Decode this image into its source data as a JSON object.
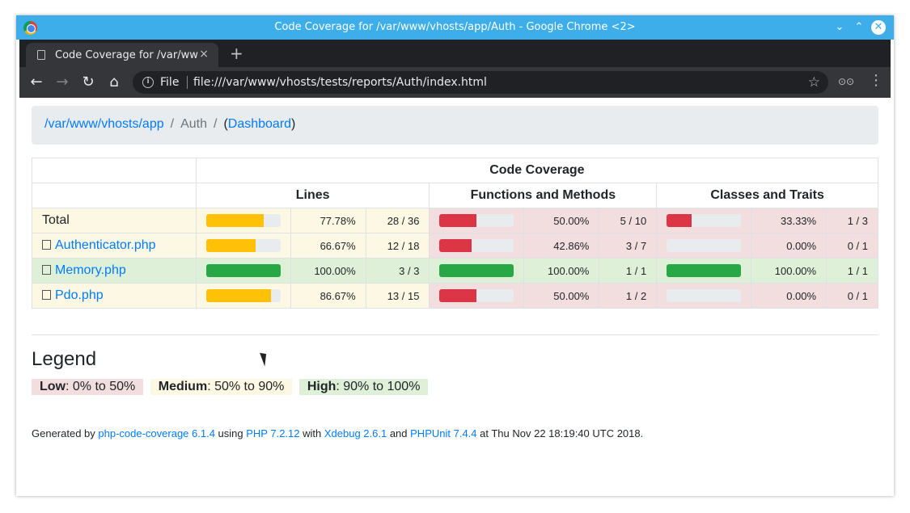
{
  "window": {
    "title": "Code Coverage for /var/www/vhosts/app/Auth - Google Chrome <2>"
  },
  "tab": {
    "title": "Code Coverage for /var/ww",
    "close": "×",
    "new_tab": "+"
  },
  "toolbar": {
    "back": "←",
    "forward": "→",
    "reload": "↻",
    "home": "⌂",
    "file_label": "File",
    "url": "file:///var/www/vhosts/tests/reports/Auth/index.html",
    "star": "☆",
    "ext": "⊙⊙",
    "menu": "⋮"
  },
  "breadcrumb": {
    "root": "/var/www/vhosts/app",
    "sep1": "/",
    "current": "Auth",
    "sep2": "/",
    "open_paren": "(",
    "dashboard": "Dashboard",
    "close_paren": ")"
  },
  "table": {
    "header_main": "Code Coverage",
    "col_lines": "Lines",
    "col_functions": "Functions and Methods",
    "col_classes": "Classes and Traits",
    "rows": [
      {
        "name": "Total",
        "is_file": false,
        "lines_fill": 0.7778,
        "lines_color": "#ffc107",
        "lines_pct": "77.78%",
        "lines_num": "28 / 36",
        "lines_bg": "bg-warning",
        "func_fill": 0.5,
        "func_color": "#dc3545",
        "func_pct": "50.00%",
        "func_num": "5 / 10",
        "func_bg": "bg-danger",
        "class_fill": 0.3333,
        "class_color": "#dc3545",
        "class_pct": "33.33%",
        "class_num": "1 / 3",
        "class_bg": "bg-danger",
        "name_bg": "bg-warning"
      },
      {
        "name": "Authenticator.php",
        "is_file": true,
        "lines_fill": 0.6667,
        "lines_color": "#ffc107",
        "lines_pct": "66.67%",
        "lines_num": "12 / 18",
        "lines_bg": "bg-warning",
        "func_fill": 0.4286,
        "func_color": "#dc3545",
        "func_pct": "42.86%",
        "func_num": "3 / 7",
        "func_bg": "bg-danger",
        "class_fill": 0,
        "class_color": "#dc3545",
        "class_pct": "0.00%",
        "class_num": "0 / 1",
        "class_bg": "bg-danger",
        "name_bg": "bg-warning"
      },
      {
        "name": "Memory.php",
        "is_file": true,
        "lines_fill": 1.0,
        "lines_color": "#28a745",
        "lines_pct": "100.00%",
        "lines_num": "3 / 3",
        "lines_bg": "bg-success",
        "func_fill": 1.0,
        "func_color": "#28a745",
        "func_pct": "100.00%",
        "func_num": "1 / 1",
        "func_bg": "bg-success",
        "class_fill": 1.0,
        "class_color": "#28a745",
        "class_pct": "100.00%",
        "class_num": "1 / 1",
        "class_bg": "bg-success",
        "name_bg": "bg-success"
      },
      {
        "name": "Pdo.php",
        "is_file": true,
        "lines_fill": 0.8667,
        "lines_color": "#ffc107",
        "lines_pct": "86.67%",
        "lines_num": "13 / 15",
        "lines_bg": "bg-warning",
        "func_fill": 0.5,
        "func_color": "#dc3545",
        "func_pct": "50.00%",
        "func_num": "1 / 2",
        "func_bg": "bg-danger",
        "class_fill": 0,
        "class_color": "#dc3545",
        "class_pct": "0.00%",
        "class_num": "0 / 1",
        "class_bg": "bg-danger",
        "name_bg": "bg-warning"
      }
    ]
  },
  "legend": {
    "title": "Legend",
    "low_label": "Low",
    "low_range": ": 0% to 50%",
    "medium_label": "Medium",
    "medium_range": ": 50% to 90%",
    "high_label": "High",
    "high_range": ": 90% to 100%"
  },
  "footer": {
    "t1": "Generated by ",
    "l1": "php-code-coverage 6.1.4",
    "t2": " using ",
    "l2": "PHP 7.2.12",
    "t3": " with ",
    "l3": "Xdebug 2.6.1",
    "t4": " and ",
    "l4": "PHPUnit 7.4.4",
    "t5": " at Thu Nov 22 18:19:40 UTC 2018."
  }
}
